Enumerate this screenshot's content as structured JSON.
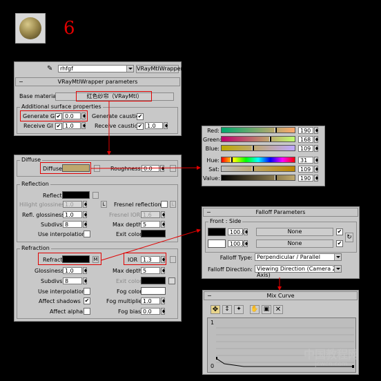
{
  "step_number": "6",
  "top_bar": {
    "material_name": "rhfgf",
    "material_type": "VRayMtlWrapper"
  },
  "wrapper": {
    "header": "VRayMtlWrapper parameters",
    "base_material_label": "Base material:",
    "base_material_value": "红色纱帘（VRayMtl）",
    "surface_group": "Additional surface properties",
    "generate_gi_label": "Generate GI",
    "generate_gi_value": "0.0",
    "receive_gi_label": "Receive GI",
    "receive_gi_value": "1.0",
    "generate_caustics_label": "Generate caustics",
    "receive_caustics_label": "Receive caustics",
    "receive_caustics_value": "1.0"
  },
  "color_picker": {
    "red_label": "Red:",
    "red_value": "190",
    "green_label": "Green:",
    "green_value": "168",
    "blue_label": "Blue:",
    "blue_value": "109",
    "hue_label": "Hue:",
    "hue_value": "31",
    "sat_label": "Sat:",
    "sat_value": "109",
    "value_label": "Value:",
    "value_value": "190",
    "levels": {
      "red": 0.745,
      "green": 0.659,
      "blue": 0.427,
      "hue": 0.122,
      "sat": 0.427,
      "value": 0.745
    }
  },
  "vray": {
    "diffuse_group": "Diffuse",
    "diffuse_label": "Diffuse",
    "roughness_label": "Roughness",
    "roughness_value": "0.0",
    "reflection_group": "Reflection",
    "reflect_label": "Reflect",
    "hilight_label": "Hilight glossiness",
    "hilight_value": "1.0",
    "l_label": "L",
    "fresnel_label": "Fresnel reflections",
    "refl_gloss_label": "Refl. glossiness",
    "refl_gloss_value": "1.0",
    "fresnel_ior_label": "Fresnel IOR",
    "fresnel_ior_value": "1.6",
    "subdivs_label": "Subdivs",
    "subdivs_value": "8",
    "max_depth_label": "Max depth",
    "max_depth_value": "5",
    "use_interp_label": "Use interpolation",
    "exit_color_label": "Exit color",
    "refraction_group": "Refraction",
    "refract_label": "Refract",
    "m_label": "M",
    "ior_label": "IOR",
    "ior_value": "1.3",
    "glossiness_label": "Glossiness",
    "glossiness_value": "1.0",
    "r_max_depth_value": "5",
    "r_subdivs_value": "8",
    "r_exit_color_label": "Exit color",
    "fog_color_label": "Fog color",
    "affect_shadows_label": "Affect shadows",
    "fog_mult_label": "Fog multiplier",
    "fog_mult_value": "1.0",
    "affect_alpha_label": "Affect alpha",
    "fog_bias_label": "Fog bias",
    "fog_bias_value": "0.0"
  },
  "falloff": {
    "header": "Falloff Parameters",
    "group": "Front : Side",
    "row1_value": "100.0",
    "row1_map": "None",
    "row2_value": "100.0",
    "row2_map": "None",
    "type_label": "Falloff Type:",
    "type_value": "Perpendicular / Parallel",
    "direction_label": "Falloff Direction:",
    "direction_value": "Viewing Direction (Camera Z-Axis)"
  },
  "mix_curve": {
    "header": "Mix Curve",
    "y_max": "1",
    "y_min": "0"
  },
  "watermark": {
    "line1": "中国教程网",
    "line2": "jcwcn.com"
  },
  "colors": {
    "diffuse_swatch": "#be a86d",
    "accent_red": "#e00000",
    "arrow_red": "#e00000"
  }
}
